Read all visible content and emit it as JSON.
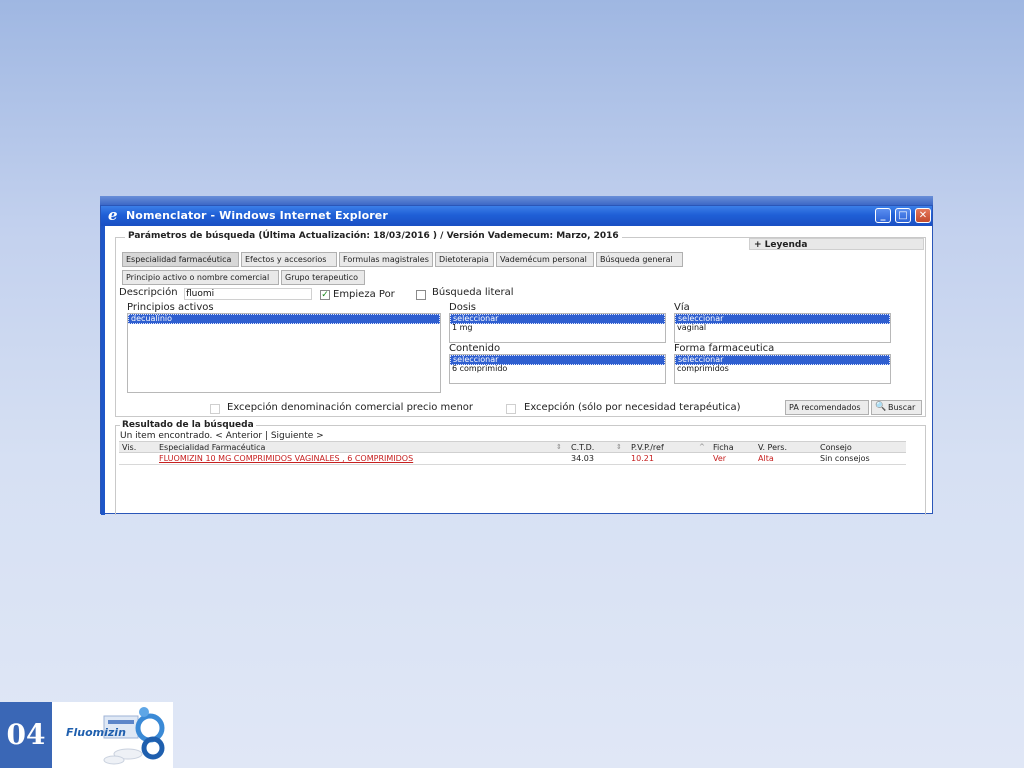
{
  "window": {
    "title": "Nomenclator - Windows Internet Explorer",
    "buttons": {
      "minimize": "_",
      "maximize": "□",
      "close": "✕"
    }
  },
  "params": {
    "legend": "Parámetros de búsqueda (Última Actualización: 18/03/2016 )   /   Versión Vademecum:  Marzo, 2016",
    "leyenda": "+ Leyenda",
    "tabs_row1": [
      "Especialidad farmacéutica",
      "Efectos y accesorios",
      "Formulas magistrales",
      "Dietoterapia",
      "Vademécum personal",
      "Búsqueda general"
    ],
    "tabs_row2": [
      "Principio activo o nombre comercial",
      "Grupo terapeutico"
    ],
    "descripcion_label": "Descripción",
    "descripcion_value": "fluomi",
    "empieza_por_label": "Empieza Por",
    "empieza_por_checked": true,
    "busqueda_literal_label": "Búsqueda literal",
    "busqueda_literal_checked": false,
    "principios_activos": {
      "label": "Principios activos",
      "options": [
        "decualinio"
      ]
    },
    "dosis": {
      "label": "Dosis",
      "options": [
        "seleccionar",
        "1 mg"
      ]
    },
    "via": {
      "label": "Vía",
      "options": [
        "seleccionar",
        "vaginal"
      ]
    },
    "contenido": {
      "label": "Contenido",
      "options": [
        "seleccionar",
        "6 comprimido"
      ]
    },
    "forma": {
      "label": "Forma farmaceutica",
      "options": [
        "seleccionar",
        "comprimidos"
      ]
    },
    "excepcion_precio": "Excepción denominación comercial precio menor",
    "excepcion_terapeutica": "Excepción (sólo por necesidad terapéutica)",
    "btn_pa": "PA recomendados",
    "btn_buscar": "Buscar"
  },
  "results": {
    "title": "Resultado de la búsqueda",
    "found_text": "Un item encontrado.",
    "prev": "< Anterior",
    "sep": "|",
    "next": "Siguiente >",
    "columns": [
      "Vis.",
      "Especialidad Farmacéutica",
      "C.T.D.",
      "P.V.P./ref",
      "Ficha",
      "V. Pers.",
      "Consejo"
    ],
    "rows": [
      {
        "name": "FLUOMIZIN 10 MG COMPRIMIDOS VAGINALES , 6 COMPRIMIDOS",
        "ctd": "34.03",
        "pvp": "10.21",
        "ficha": "Ver",
        "vpers": "Alta",
        "consejo": "Sin consejos"
      }
    ]
  },
  "slide": {
    "number": "04",
    "logo": "Fluomizin"
  },
  "colors": {
    "titlebar": "#1f5fd6",
    "selection": "#2f5fd0",
    "red_value": "#c62020",
    "slide_badge": "#3a67b6"
  }
}
